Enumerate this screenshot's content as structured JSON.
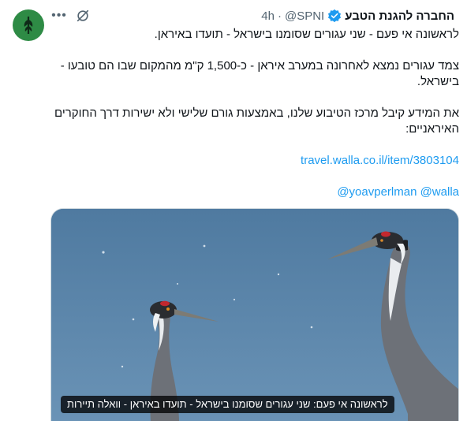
{
  "account": {
    "display_name": "החברה להגנת הטבע",
    "handle": "@SPNI",
    "separator": "·",
    "time": "4h"
  },
  "tweet": {
    "line1": "לראשונה אי פעם - שני עגורים שסומנו בישראל - תועדו באיראן.",
    "para2": "צמד עגורים נמצא לאחרונה במערב איראן - כ-1,500 ק\"מ מהמקום שבו הם טובעו - בישראל.",
    "para3": "את המידע קיבל מרכז הטיבוע שלנו, באמצעות גורם שלישי ולא ישירות דרך החוקרים האיראניים:",
    "link": "travel.walla.co.il/item/3803104",
    "mentions": "@yoavperlman @walla"
  },
  "card": {
    "caption": "לראשונה אי פעם: שני עגורים שסומנו בישראל - תועדו באיראן - וואלה תיירות"
  },
  "icons": {
    "more": "more-icon",
    "grok": "grok-icon",
    "verified": "verified-badge-icon"
  },
  "colors": {
    "accent": "#1d9bf0",
    "avatar_bg": "#2e8b45",
    "sky": "#5a83a8"
  }
}
